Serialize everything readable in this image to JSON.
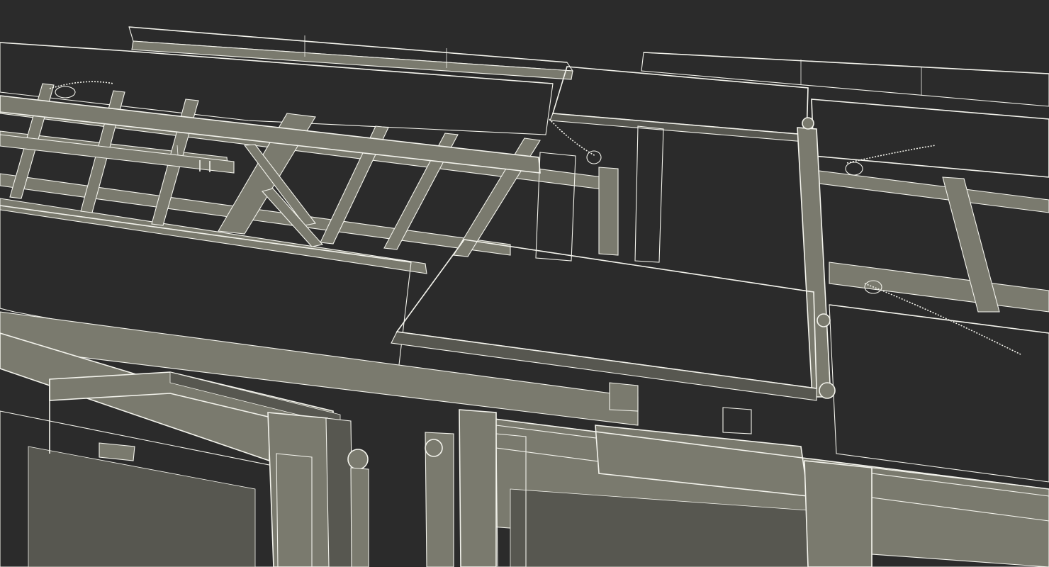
{
  "scene": {
    "colors": {
      "background": "#2b2b2b",
      "mesh_surface": "#7a7a6e",
      "mesh_shadow": "#575750",
      "wireframe": "#f3f3ec",
      "perforation": "#141414"
    }
  }
}
